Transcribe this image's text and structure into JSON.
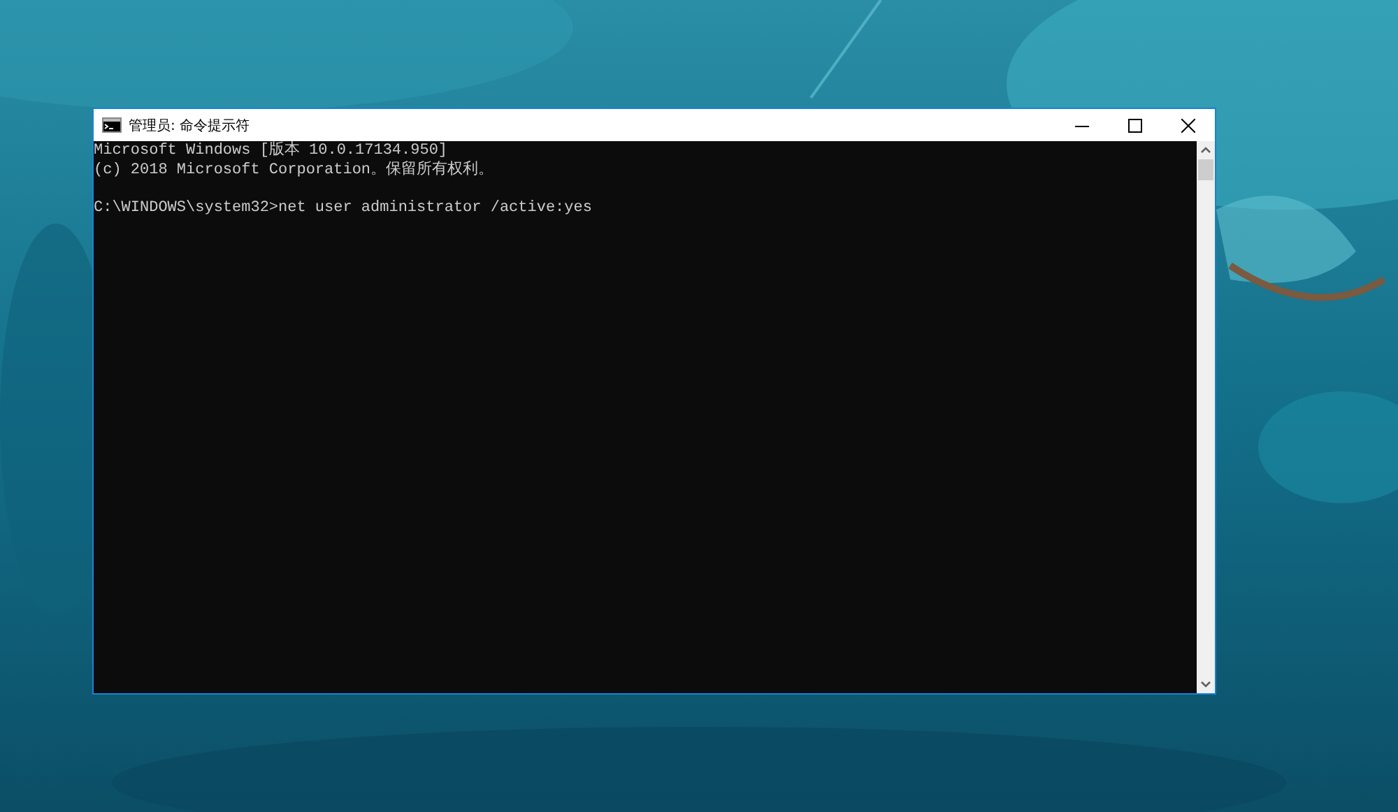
{
  "window": {
    "title": "管理员: 命令提示符"
  },
  "console": {
    "banner": [
      "Microsoft Windows [版本 10.0.17134.950]",
      "(c) 2018 Microsoft Corporation。保留所有权利。"
    ],
    "command": "C:\\WINDOWS\\system32>net user administrator /active:yes"
  }
}
